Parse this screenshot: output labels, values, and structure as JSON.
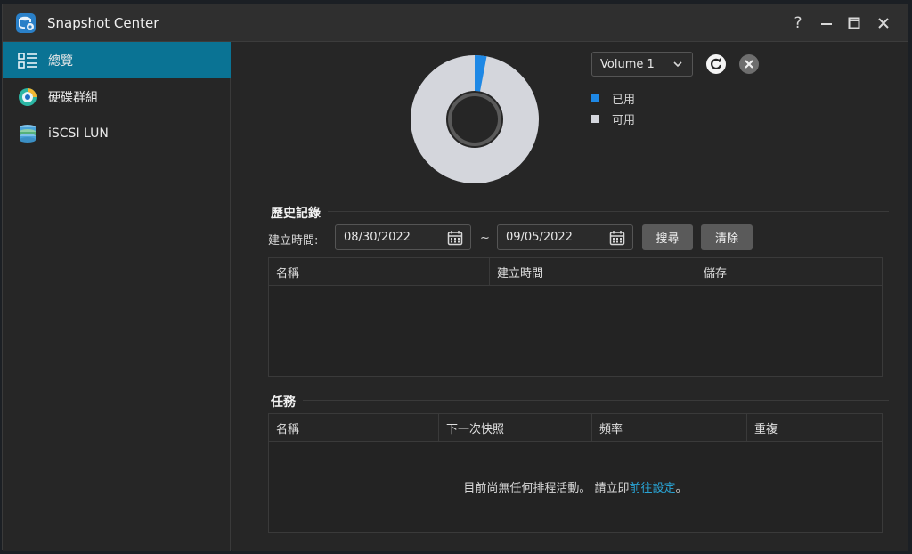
{
  "window": {
    "title": "Snapshot Center"
  },
  "sidebar": {
    "items": [
      {
        "label": "總覽",
        "icon": "overview-list-icon",
        "active": true
      },
      {
        "label": "硬碟群組",
        "icon": "storage-pool-icon",
        "active": false
      },
      {
        "label": "iSCSI LUN",
        "icon": "database-icon",
        "active": false
      }
    ]
  },
  "overview": {
    "volume_select": "Volume 1",
    "usage": {
      "used_fraction": 0.03,
      "used_color": "#1e88e5",
      "free_color": "#d4d6dc"
    },
    "legend": [
      {
        "label": "已用",
        "color": "#1e88e5"
      },
      {
        "label": "可用",
        "color": "#d4d6dc"
      }
    ]
  },
  "history": {
    "title": "歷史記錄",
    "created_label": "建立時間:",
    "date_from": "08/30/2022",
    "separator": "~",
    "date_to": "09/05/2022",
    "search_label": "搜尋",
    "clear_label": "清除",
    "columns": [
      "名稱",
      "建立時間",
      "儲存"
    ]
  },
  "tasks": {
    "title": "任務",
    "columns": [
      "名稱",
      "下一次快照",
      "頻率",
      "重複"
    ],
    "empty_text": "目前尚無任何排程活動。 請立即",
    "empty_link": "前往設定",
    "empty_suffix": "。"
  },
  "colors": {
    "accent": "#0a7394",
    "link": "#29a3d3"
  }
}
